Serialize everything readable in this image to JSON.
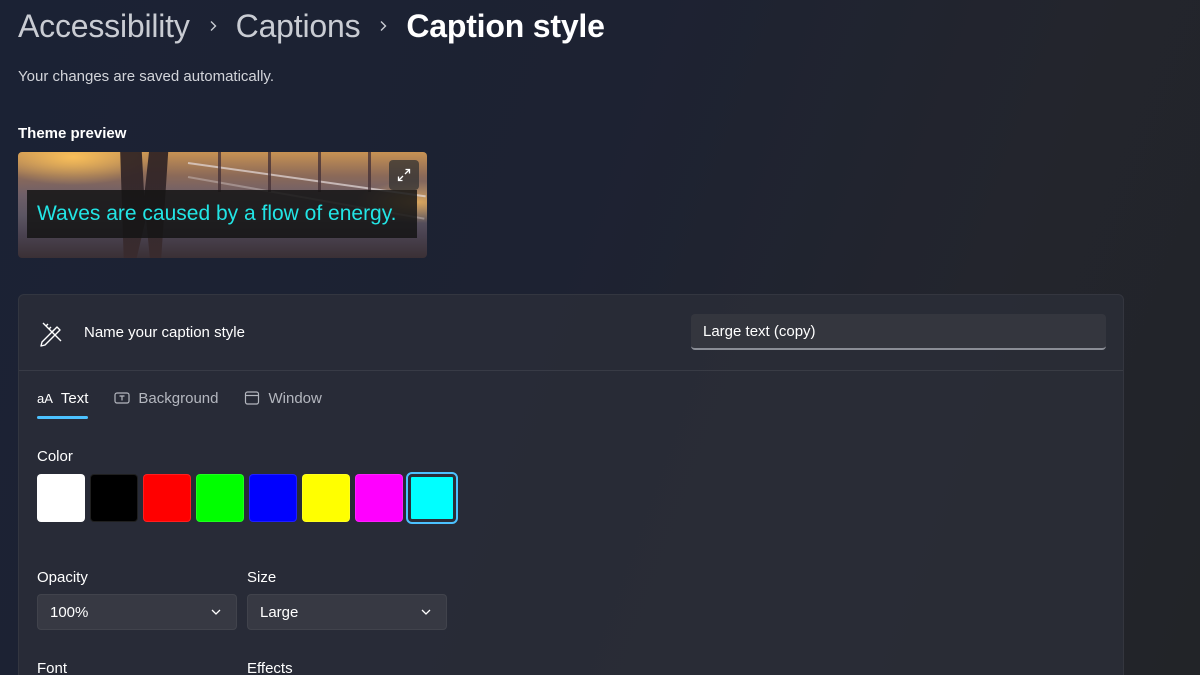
{
  "breadcrumb": {
    "items": [
      "Accessibility",
      "Captions"
    ],
    "current": "Caption style"
  },
  "autosave_text": "Your changes are saved automatically.",
  "preview": {
    "label": "Theme preview",
    "caption_text": "Waves are caused by a flow of energy.",
    "caption_color": "#22e5e5"
  },
  "name_row": {
    "label": "Name your caption style",
    "value": "Large text (copy)"
  },
  "tabs": [
    {
      "icon": "aA",
      "label": "Text",
      "active": true
    },
    {
      "icon": "background-icon",
      "label": "Background",
      "active": false
    },
    {
      "icon": "window-icon",
      "label": "Window",
      "active": false
    }
  ],
  "color": {
    "label": "Color",
    "swatches": [
      "#ffffff",
      "#000000",
      "#ff0000",
      "#00ff00",
      "#0000ff",
      "#ffff00",
      "#ff00ff",
      "#00ffff"
    ],
    "selected": "#00ffff"
  },
  "opacity": {
    "label": "Opacity",
    "value": "100%"
  },
  "size": {
    "label": "Size",
    "value": "Large"
  },
  "font": {
    "label": "Font"
  },
  "effects": {
    "label": "Effects"
  },
  "accent": "#4cc2ff"
}
